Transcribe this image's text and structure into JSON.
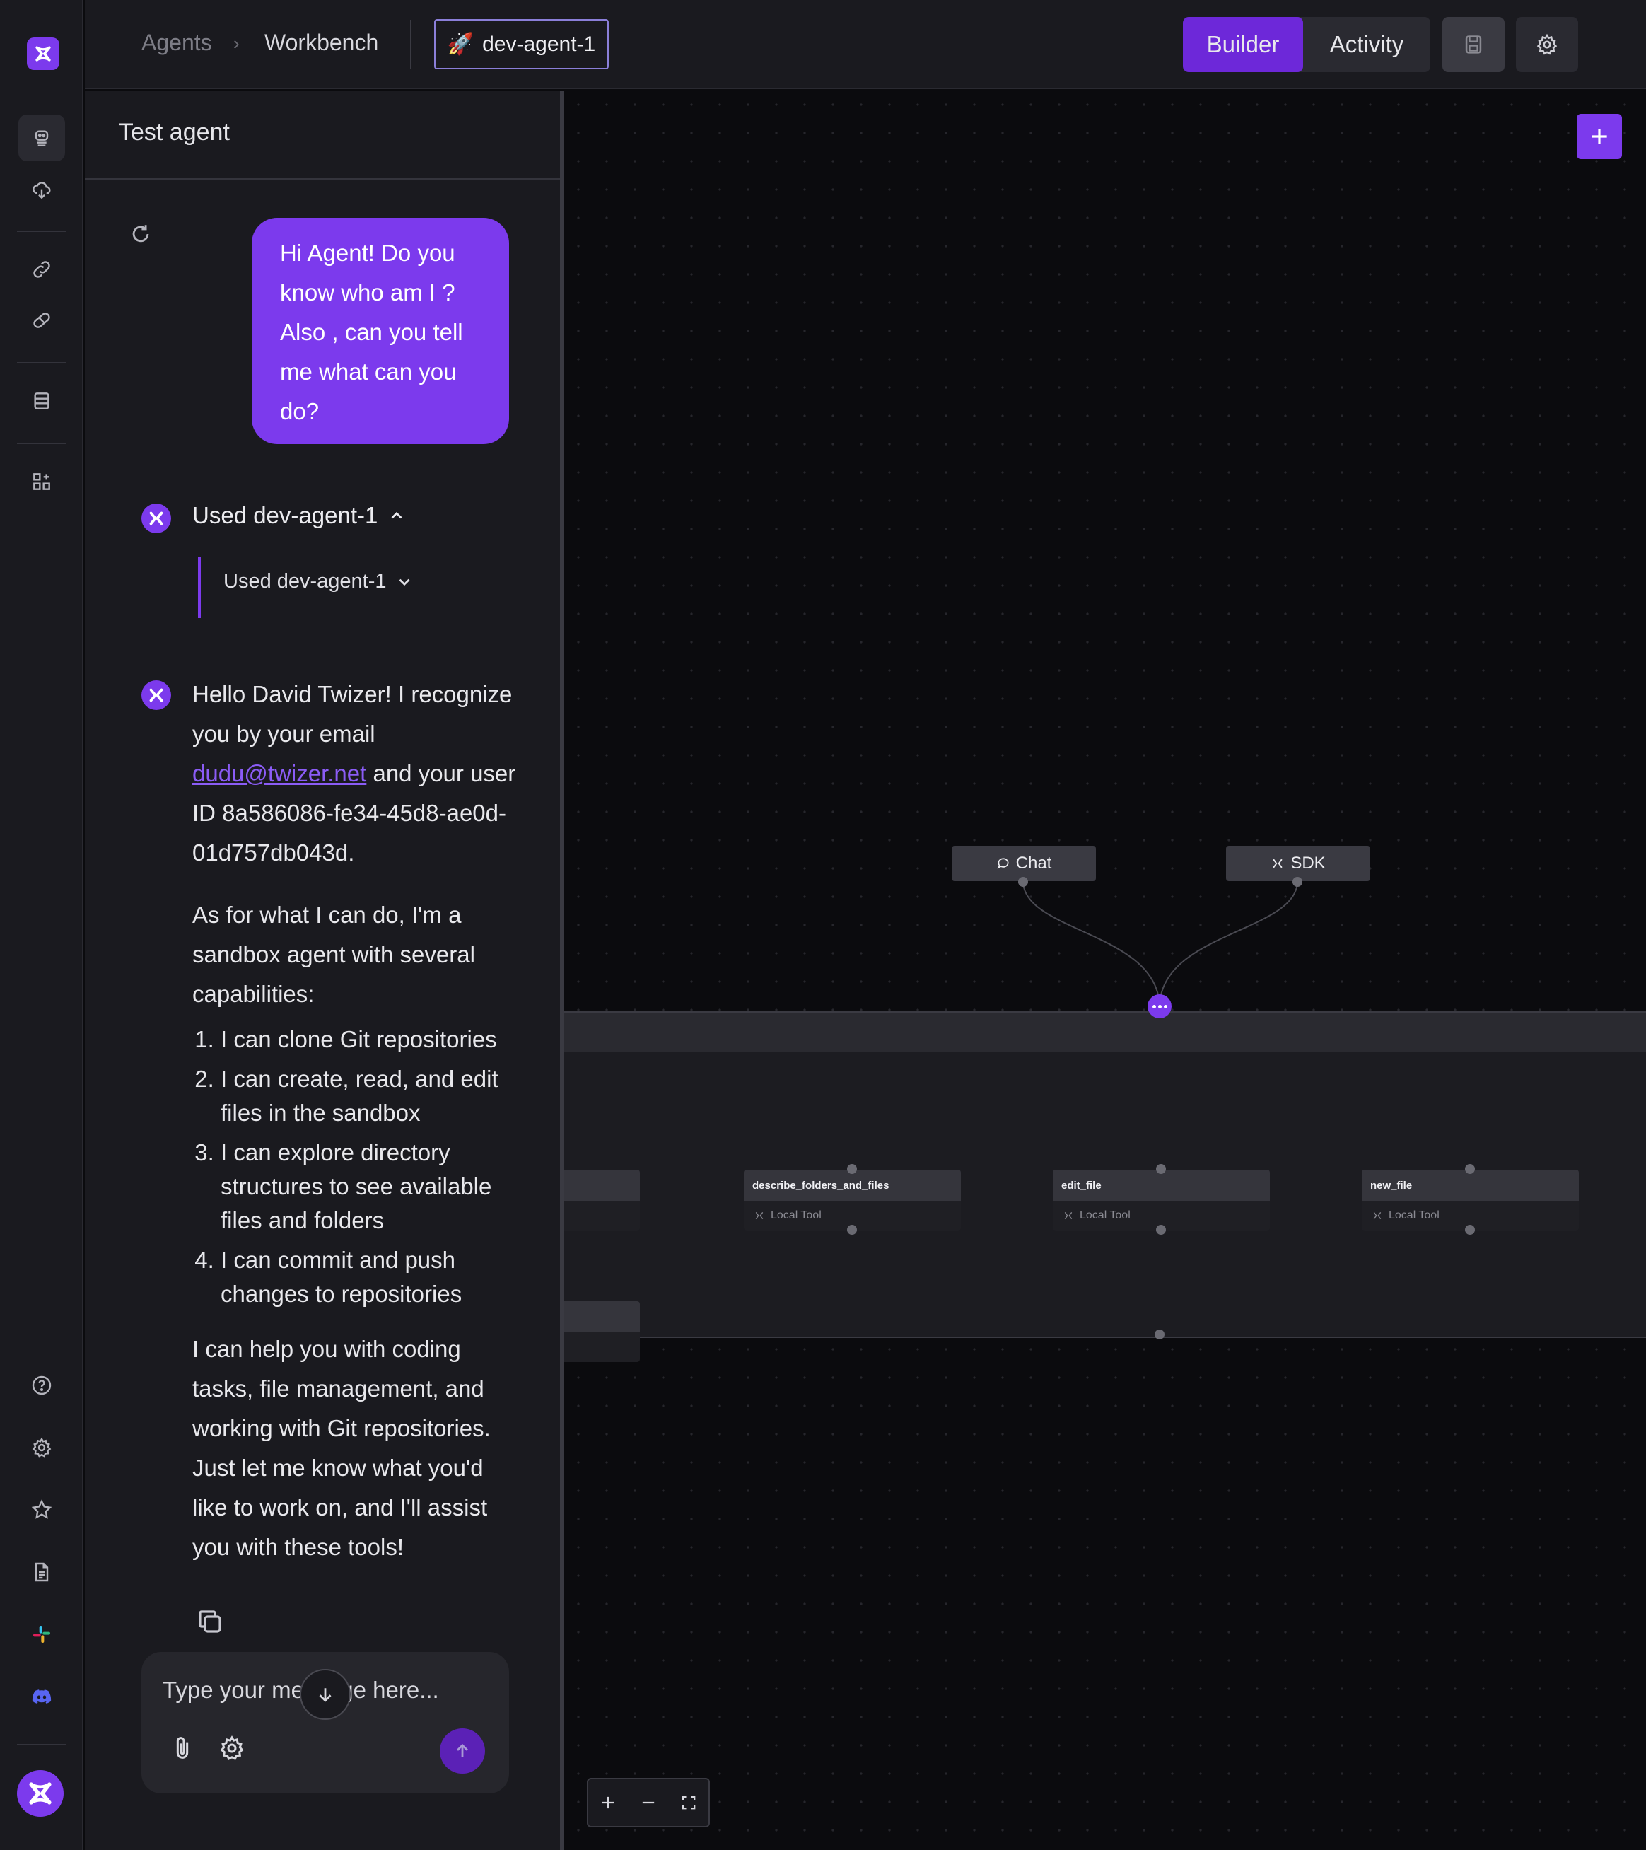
{
  "header": {
    "breadcrumb": [
      "Agents",
      "Workbench"
    ],
    "breadcrumb_separator": "›",
    "agent_chip": {
      "emoji": "🚀",
      "name": "dev-agent-1"
    },
    "view_toggle": {
      "active": "Builder",
      "inactive": "Activity"
    },
    "icons": {
      "save": "save-icon",
      "settings": "gear-icon"
    }
  },
  "rail": {
    "icons": [
      "logo-icon",
      "agent-icon",
      "cloud-deploy-icon",
      "link-icon",
      "pill-icon",
      "database-icon",
      "apps-add-icon",
      "help-icon",
      "gear-icon",
      "star-icon",
      "document-icon",
      "slack-icon",
      "discord-icon",
      "avatar-logo-icon"
    ]
  },
  "panel": {
    "title": "Test agent",
    "user_message": "Hi Agent! Do you know who am I ? Also , can you tell me what can you do?",
    "tool_call": {
      "label": "Used dev-agent-1",
      "sub_label": "Used dev-agent-1"
    },
    "reply": {
      "p1_before": "Hello David Twizer! I recognize you by your email ",
      "email": "dudu@twizer.net",
      "p1_after": " and your user ID 8a586086-fe34-45d8-ae0d-01d757db043d.",
      "p2": "As for what I can do, I'm a sandbox agent with several capabilities:",
      "capabilities": [
        "I can clone Git repositories",
        "I can create, read, and edit files in the sandbox",
        "I can explore directory structures to see available files and folders",
        "I can commit and push changes to repositories"
      ],
      "p3": "I can help you with coding tasks, file management, and working with Git repositories. Just let me know what you'd like to work on, and I'll assist you with these tools!"
    },
    "composer": {
      "placeholder": "Type your message here..."
    }
  },
  "canvas": {
    "triggers": [
      {
        "label": "Chat",
        "icon": "chat-icon"
      },
      {
        "label": "SDK",
        "icon": "sdk-icon"
      }
    ],
    "tools": [
      {
        "name": "describe_folders_and_files",
        "type": "Local Tool"
      },
      {
        "name": "edit_file",
        "type": "Local Tool"
      },
      {
        "name": "new_file",
        "type": "Local Tool"
      }
    ],
    "accent": "#7c3aed"
  }
}
